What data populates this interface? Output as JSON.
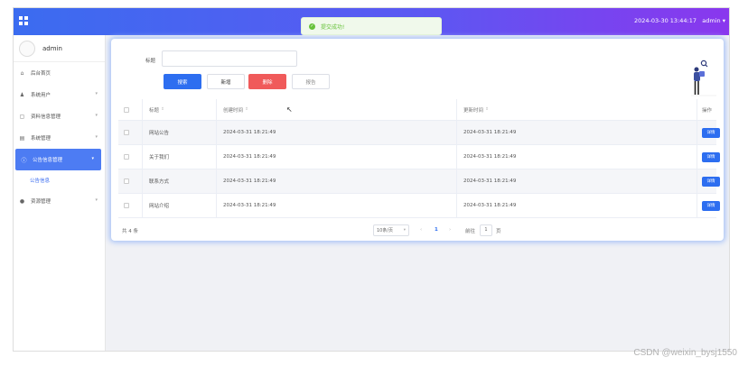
{
  "header": {
    "datetime": "2024-03-30 13:44:17",
    "user_menu": "admin ▾"
  },
  "toast": {
    "message": "提交成功!"
  },
  "sidebar": {
    "user_name": "admin",
    "menu": [
      {
        "icon": "home-icon",
        "glyph": "⌂",
        "label": "后台首页",
        "has_arrow": false
      },
      {
        "icon": "user-icon",
        "glyph": "♟",
        "label": "系统用户",
        "has_arrow": true
      },
      {
        "icon": "calendar-icon",
        "glyph": "▢",
        "label": "资料信息管理",
        "has_arrow": true
      },
      {
        "icon": "file-icon",
        "glyph": "▤",
        "label": "系统管理",
        "has_arrow": true
      },
      {
        "icon": "info-icon",
        "glyph": "ⓘ",
        "label": "公告信息管理",
        "has_arrow": true,
        "active": true
      },
      {
        "icon": "location-icon",
        "glyph": "●",
        "label": "资源管理",
        "has_arrow": true
      }
    ],
    "submenu_label": "公告信息"
  },
  "search": {
    "label": "标题",
    "placeholder": "",
    "buttons": {
      "search": "搜索",
      "add": "新增",
      "delete": "删除",
      "notice": "报告"
    }
  },
  "table": {
    "headers": {
      "title": "标题",
      "created": "创建时间",
      "updated": "更新时间",
      "operation": "操作"
    },
    "sort_glyph": "⇕",
    "rows": [
      {
        "title": "网站公告",
        "created": "2024-03-31 18:21:49",
        "updated": "2024-03-31 18:21:49",
        "action": "详情"
      },
      {
        "title": "关于我们",
        "created": "2024-03-31 18:21:49",
        "updated": "2024-03-31 18:21:49",
        "action": "详情"
      },
      {
        "title": "联系方式",
        "created": "2024-03-31 18:21:49",
        "updated": "2024-03-31 18:21:49",
        "action": "详情"
      },
      {
        "title": "网站介绍",
        "created": "2024-03-31 18:21:49",
        "updated": "2024-03-31 18:21:49",
        "action": "详情"
      }
    ]
  },
  "pagination": {
    "total": "共 4 条",
    "page_size": "10条/页",
    "prev": "‹",
    "current_page": "1",
    "next": "›",
    "goto_label": "前往",
    "goto_value": "1",
    "page_unit": "页"
  },
  "watermark": "CSDN @weixin_bysj1550",
  "colors": {
    "primary": "#2d6ef0",
    "danger": "#f05a5a",
    "success": "#67c23a",
    "header_gradient_start": "#3b6cf0",
    "header_gradient_end": "#8a37ee"
  }
}
